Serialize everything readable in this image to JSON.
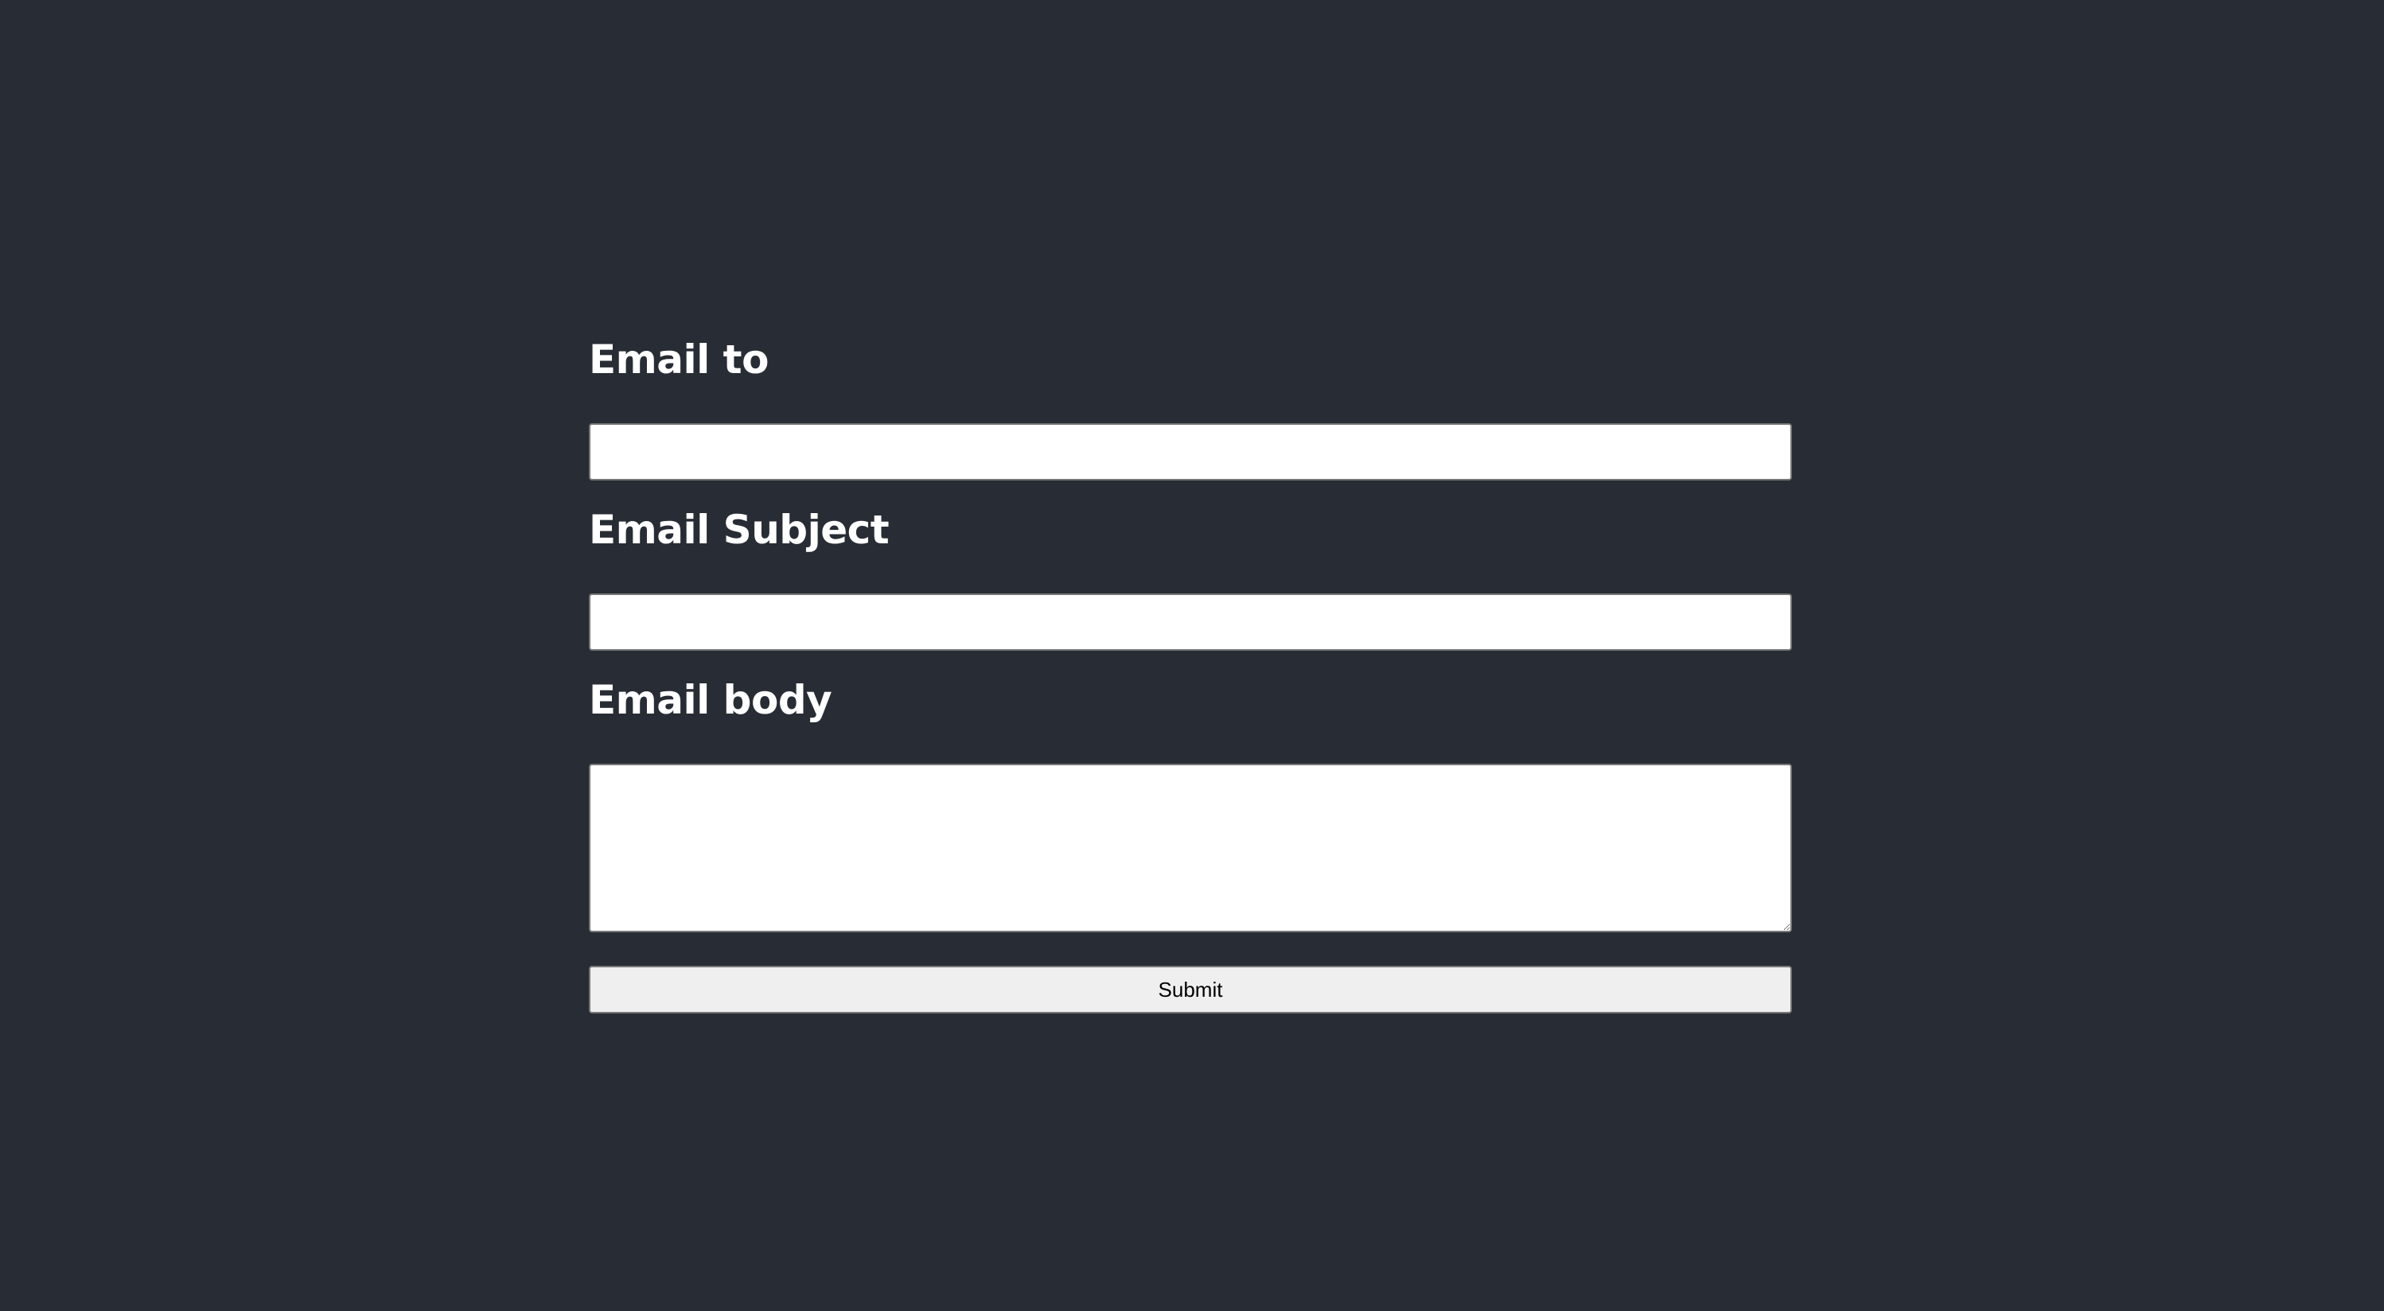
{
  "form": {
    "to": {
      "label": "Email to",
      "value": "",
      "placeholder": ""
    },
    "subject": {
      "label": "Email Subject",
      "value": "",
      "placeholder": ""
    },
    "body": {
      "label": "Email body",
      "value": "",
      "placeholder": ""
    },
    "submit_label": "Submit"
  },
  "colors": {
    "background": "#282c34",
    "label_text": "#ffffff",
    "input_background": "#ffffff",
    "button_background": "#efefef"
  }
}
